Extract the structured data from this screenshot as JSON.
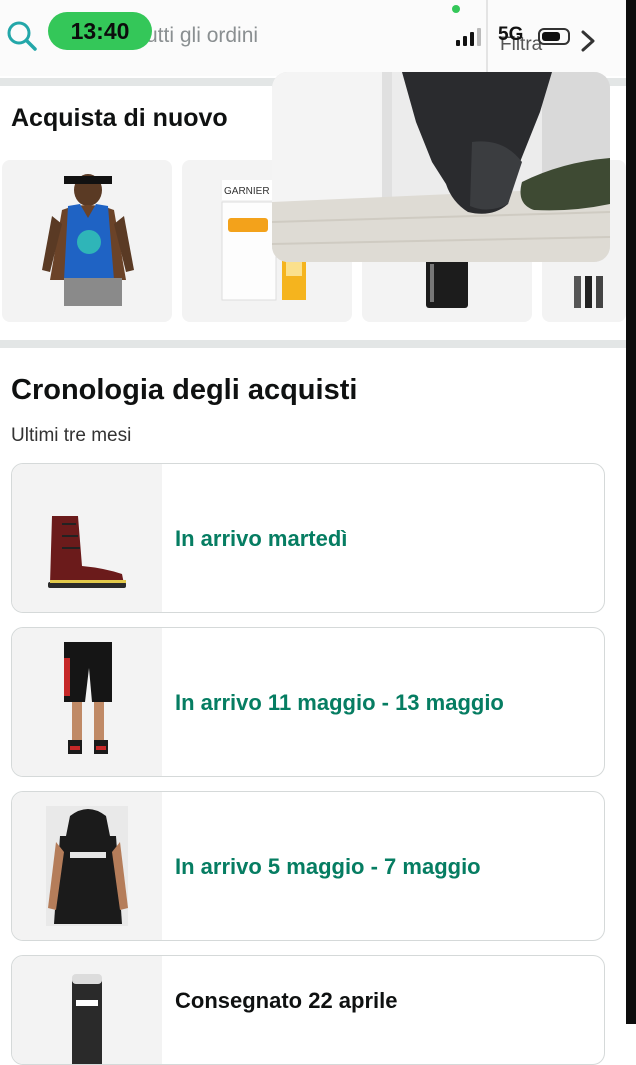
{
  "status_bar": {
    "time": "13:40",
    "network": "5G"
  },
  "search": {
    "text": "utti gli ordini",
    "filter_label": "Filtra"
  },
  "buy_again": {
    "title": "Acquista di nuovo"
  },
  "history": {
    "title": "Cronologia degli acquisti",
    "subtitle": "Ultimi tre mesi",
    "orders": [
      {
        "status": "In arrivo martedì"
      },
      {
        "status": "In arrivo 11 maggio - 13 maggio"
      },
      {
        "status": "In arrivo 5 maggio - 7 maggio"
      },
      {
        "status": "Consegnato 22 aprile"
      }
    ]
  },
  "colors": {
    "accent_green": "#067d62",
    "search_teal": "#23a7a9",
    "time_pill": "#34c759"
  },
  "icons": [
    "search-icon",
    "chevron-right-icon",
    "signal-icon",
    "battery-icon"
  ]
}
